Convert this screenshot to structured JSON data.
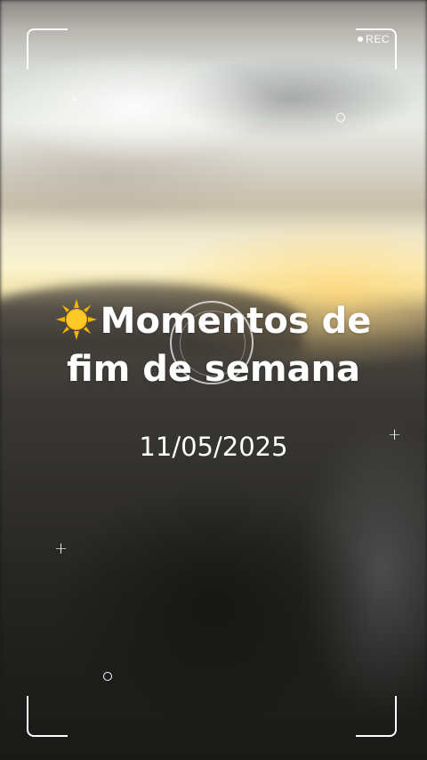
{
  "overlay": {
    "rec_label": "REC",
    "title_line1": "Momentos de",
    "title_line2": "fim de semana",
    "title_emoji_icon": "sun-icon",
    "date": "11/05/2025"
  },
  "colors": {
    "text": "#ffffff",
    "sun": "#f7b500",
    "sun_core": "#ffc928"
  }
}
